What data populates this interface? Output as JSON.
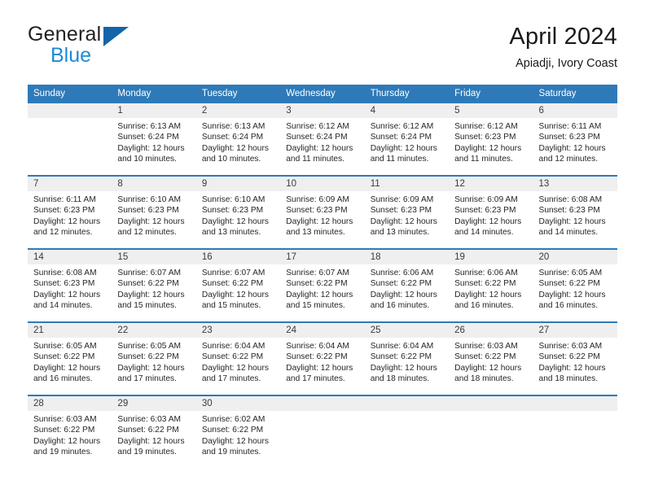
{
  "brand": {
    "name_part1": "General",
    "name_part2": "Blue",
    "logo_icon": "triangle-logo-icon"
  },
  "header": {
    "title": "April 2024",
    "subtitle": "Apiadji, Ivory Coast"
  },
  "calendar": {
    "weekday_headers": [
      "Sunday",
      "Monday",
      "Tuesday",
      "Wednesday",
      "Thursday",
      "Friday",
      "Saturday"
    ],
    "accent_color": "#2e7ab8",
    "daynum_band_color": "#efefef",
    "weeks": [
      [
        {
          "day": "",
          "sunrise": "",
          "sunset": "",
          "daylight_line1": "",
          "daylight_line2": ""
        },
        {
          "day": "1",
          "sunrise": "Sunrise: 6:13 AM",
          "sunset": "Sunset: 6:24 PM",
          "daylight_line1": "Daylight: 12 hours",
          "daylight_line2": "and 10 minutes."
        },
        {
          "day": "2",
          "sunrise": "Sunrise: 6:13 AM",
          "sunset": "Sunset: 6:24 PM",
          "daylight_line1": "Daylight: 12 hours",
          "daylight_line2": "and 10 minutes."
        },
        {
          "day": "3",
          "sunrise": "Sunrise: 6:12 AM",
          "sunset": "Sunset: 6:24 PM",
          "daylight_line1": "Daylight: 12 hours",
          "daylight_line2": "and 11 minutes."
        },
        {
          "day": "4",
          "sunrise": "Sunrise: 6:12 AM",
          "sunset": "Sunset: 6:24 PM",
          "daylight_line1": "Daylight: 12 hours",
          "daylight_line2": "and 11 minutes."
        },
        {
          "day": "5",
          "sunrise": "Sunrise: 6:12 AM",
          "sunset": "Sunset: 6:23 PM",
          "daylight_line1": "Daylight: 12 hours",
          "daylight_line2": "and 11 minutes."
        },
        {
          "day": "6",
          "sunrise": "Sunrise: 6:11 AM",
          "sunset": "Sunset: 6:23 PM",
          "daylight_line1": "Daylight: 12 hours",
          "daylight_line2": "and 12 minutes."
        }
      ],
      [
        {
          "day": "7",
          "sunrise": "Sunrise: 6:11 AM",
          "sunset": "Sunset: 6:23 PM",
          "daylight_line1": "Daylight: 12 hours",
          "daylight_line2": "and 12 minutes."
        },
        {
          "day": "8",
          "sunrise": "Sunrise: 6:10 AM",
          "sunset": "Sunset: 6:23 PM",
          "daylight_line1": "Daylight: 12 hours",
          "daylight_line2": "and 12 minutes."
        },
        {
          "day": "9",
          "sunrise": "Sunrise: 6:10 AM",
          "sunset": "Sunset: 6:23 PM",
          "daylight_line1": "Daylight: 12 hours",
          "daylight_line2": "and 13 minutes."
        },
        {
          "day": "10",
          "sunrise": "Sunrise: 6:09 AM",
          "sunset": "Sunset: 6:23 PM",
          "daylight_line1": "Daylight: 12 hours",
          "daylight_line2": "and 13 minutes."
        },
        {
          "day": "11",
          "sunrise": "Sunrise: 6:09 AM",
          "sunset": "Sunset: 6:23 PM",
          "daylight_line1": "Daylight: 12 hours",
          "daylight_line2": "and 13 minutes."
        },
        {
          "day": "12",
          "sunrise": "Sunrise: 6:09 AM",
          "sunset": "Sunset: 6:23 PM",
          "daylight_line1": "Daylight: 12 hours",
          "daylight_line2": "and 14 minutes."
        },
        {
          "day": "13",
          "sunrise": "Sunrise: 6:08 AM",
          "sunset": "Sunset: 6:23 PM",
          "daylight_line1": "Daylight: 12 hours",
          "daylight_line2": "and 14 minutes."
        }
      ],
      [
        {
          "day": "14",
          "sunrise": "Sunrise: 6:08 AM",
          "sunset": "Sunset: 6:23 PM",
          "daylight_line1": "Daylight: 12 hours",
          "daylight_line2": "and 14 minutes."
        },
        {
          "day": "15",
          "sunrise": "Sunrise: 6:07 AM",
          "sunset": "Sunset: 6:22 PM",
          "daylight_line1": "Daylight: 12 hours",
          "daylight_line2": "and 15 minutes."
        },
        {
          "day": "16",
          "sunrise": "Sunrise: 6:07 AM",
          "sunset": "Sunset: 6:22 PM",
          "daylight_line1": "Daylight: 12 hours",
          "daylight_line2": "and 15 minutes."
        },
        {
          "day": "17",
          "sunrise": "Sunrise: 6:07 AM",
          "sunset": "Sunset: 6:22 PM",
          "daylight_line1": "Daylight: 12 hours",
          "daylight_line2": "and 15 minutes."
        },
        {
          "day": "18",
          "sunrise": "Sunrise: 6:06 AM",
          "sunset": "Sunset: 6:22 PM",
          "daylight_line1": "Daylight: 12 hours",
          "daylight_line2": "and 16 minutes."
        },
        {
          "day": "19",
          "sunrise": "Sunrise: 6:06 AM",
          "sunset": "Sunset: 6:22 PM",
          "daylight_line1": "Daylight: 12 hours",
          "daylight_line2": "and 16 minutes."
        },
        {
          "day": "20",
          "sunrise": "Sunrise: 6:05 AM",
          "sunset": "Sunset: 6:22 PM",
          "daylight_line1": "Daylight: 12 hours",
          "daylight_line2": "and 16 minutes."
        }
      ],
      [
        {
          "day": "21",
          "sunrise": "Sunrise: 6:05 AM",
          "sunset": "Sunset: 6:22 PM",
          "daylight_line1": "Daylight: 12 hours",
          "daylight_line2": "and 16 minutes."
        },
        {
          "day": "22",
          "sunrise": "Sunrise: 6:05 AM",
          "sunset": "Sunset: 6:22 PM",
          "daylight_line1": "Daylight: 12 hours",
          "daylight_line2": "and 17 minutes."
        },
        {
          "day": "23",
          "sunrise": "Sunrise: 6:04 AM",
          "sunset": "Sunset: 6:22 PM",
          "daylight_line1": "Daylight: 12 hours",
          "daylight_line2": "and 17 minutes."
        },
        {
          "day": "24",
          "sunrise": "Sunrise: 6:04 AM",
          "sunset": "Sunset: 6:22 PM",
          "daylight_line1": "Daylight: 12 hours",
          "daylight_line2": "and 17 minutes."
        },
        {
          "day": "25",
          "sunrise": "Sunrise: 6:04 AM",
          "sunset": "Sunset: 6:22 PM",
          "daylight_line1": "Daylight: 12 hours",
          "daylight_line2": "and 18 minutes."
        },
        {
          "day": "26",
          "sunrise": "Sunrise: 6:03 AM",
          "sunset": "Sunset: 6:22 PM",
          "daylight_line1": "Daylight: 12 hours",
          "daylight_line2": "and 18 minutes."
        },
        {
          "day": "27",
          "sunrise": "Sunrise: 6:03 AM",
          "sunset": "Sunset: 6:22 PM",
          "daylight_line1": "Daylight: 12 hours",
          "daylight_line2": "and 18 minutes."
        }
      ],
      [
        {
          "day": "28",
          "sunrise": "Sunrise: 6:03 AM",
          "sunset": "Sunset: 6:22 PM",
          "daylight_line1": "Daylight: 12 hours",
          "daylight_line2": "and 19 minutes."
        },
        {
          "day": "29",
          "sunrise": "Sunrise: 6:03 AM",
          "sunset": "Sunset: 6:22 PM",
          "daylight_line1": "Daylight: 12 hours",
          "daylight_line2": "and 19 minutes."
        },
        {
          "day": "30",
          "sunrise": "Sunrise: 6:02 AM",
          "sunset": "Sunset: 6:22 PM",
          "daylight_line1": "Daylight: 12 hours",
          "daylight_line2": "and 19 minutes."
        },
        {
          "day": "",
          "sunrise": "",
          "sunset": "",
          "daylight_line1": "",
          "daylight_line2": ""
        },
        {
          "day": "",
          "sunrise": "",
          "sunset": "",
          "daylight_line1": "",
          "daylight_line2": ""
        },
        {
          "day": "",
          "sunrise": "",
          "sunset": "",
          "daylight_line1": "",
          "daylight_line2": ""
        },
        {
          "day": "",
          "sunrise": "",
          "sunset": "",
          "daylight_line1": "",
          "daylight_line2": ""
        }
      ]
    ]
  }
}
